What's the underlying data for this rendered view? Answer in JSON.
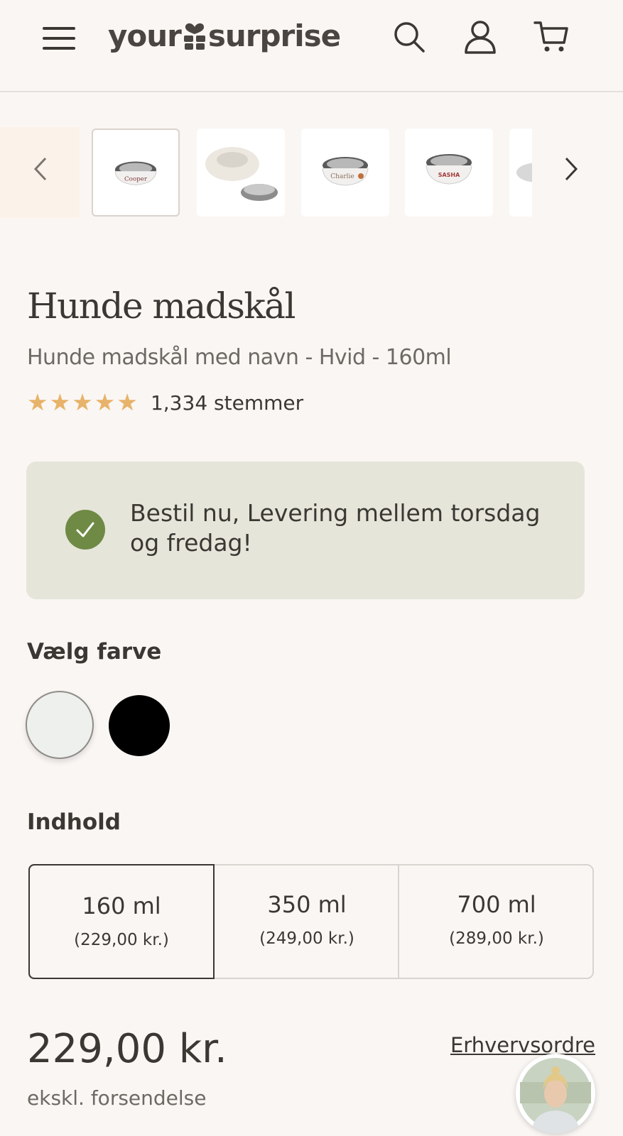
{
  "header": {
    "logo": {
      "left": "your",
      "right": "surprise"
    },
    "icons": [
      "menu-icon",
      "search-icon",
      "user-icon",
      "cart-icon"
    ]
  },
  "gallery": {
    "thumbnails": [
      {
        "label": "Cooper"
      },
      {
        "label": ""
      },
      {
        "label": "Charlie"
      },
      {
        "label": "SASHA"
      }
    ]
  },
  "product": {
    "title": "Hunde madskål",
    "subtitle": "Hunde madskål med navn - Hvid - 160ml",
    "rating": 5,
    "votes": "1,334 stemmer"
  },
  "delivery": {
    "message": "Bestil nu, Levering mellem torsdag og fredag!"
  },
  "color": {
    "heading": "Vælg farve",
    "options": [
      {
        "name": "Hvid",
        "hex": "#eef0ee",
        "selected": true
      },
      {
        "name": "Sort",
        "hex": "#000000",
        "selected": false
      }
    ]
  },
  "content": {
    "heading": "Indhold",
    "options": [
      {
        "size": "160 ml",
        "price": "(229,00 kr.)",
        "selected": true
      },
      {
        "size": "350 ml",
        "price": "(249,00 kr.)",
        "selected": false
      },
      {
        "size": "700 ml",
        "price": "(289,00 kr.)",
        "selected": false
      }
    ]
  },
  "pricing": {
    "price": "229,00 kr.",
    "shipping": "ekskl. forsendelse",
    "business_link": "Erhvervsordre"
  },
  "colors": {
    "background": "#faf6f3",
    "star": "#e7b36a",
    "check": "#6e8a45",
    "delivery_bg": "#e6e5da"
  }
}
